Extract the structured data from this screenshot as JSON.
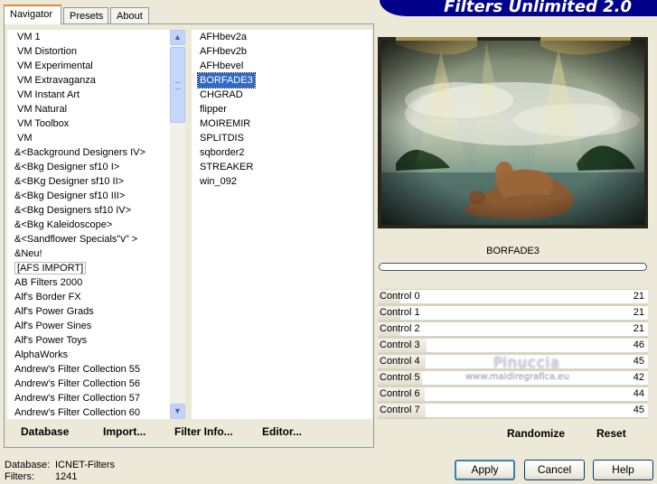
{
  "banner": {
    "title": "Filters Unlimited 2.0"
  },
  "tabs": [
    {
      "label": "Navigator"
    },
    {
      "label": "Presets"
    },
    {
      "label": "About"
    }
  ],
  "categories": [
    "VM 1",
    "VM Distortion",
    "VM Experimental",
    "VM Extravaganza",
    "VM Instant Art",
    "VM Natural",
    "VM Toolbox",
    "VM",
    "&<Background Designers IV>",
    "&<Bkg Designer sf10 I>",
    "&<BKg Designer sf10 II>",
    "&<Bkg Designer sf10 III>",
    "&<Bkg Designers sf10 IV>",
    "&<Bkg Kaleidoscope>",
    "&<Sandflower Specials\"v\" >",
    "&Neu!",
    "[AFS IMPORT]",
    "AB Filters 2000",
    "Alf's Border FX",
    "Alf's Power Grads",
    "Alf's Power Sines",
    "Alf's Power Toys",
    "AlphaWorks",
    "Andrew's Filter Collection 55",
    "Andrew's Filter Collection 56",
    "Andrew's Filter Collection 57",
    "Andrew's Filter Collection 60"
  ],
  "categories_selected": "[AFS IMPORT]",
  "filters": [
    "AFHbev2a",
    "AFHbev2b",
    "AFHbevel",
    "BORFADE3",
    "CHGRAD",
    "flipper",
    "MOIREMIR",
    "SPLITDIS",
    "sqborder2",
    "STREAKER",
    "win_092"
  ],
  "filters_selected": "BORFADE3",
  "toolbar": {
    "database": "Database",
    "import": "Import...",
    "filter_info": "Filter Info...",
    "editor": "Editor..."
  },
  "preview": {
    "filter_name": "BORFADE3"
  },
  "controls": [
    {
      "label": "Control 0",
      "value": "21",
      "level": 0.082
    },
    {
      "label": "Control 1",
      "value": "21",
      "level": 0.082
    },
    {
      "label": "Control 2",
      "value": "21",
      "level": 0.082
    },
    {
      "label": "Control 3",
      "value": "46",
      "level": 0.18
    },
    {
      "label": "Control 4",
      "value": "45",
      "level": 0.176
    },
    {
      "label": "Control 5",
      "value": "42",
      "level": 0.165
    },
    {
      "label": "Control 6",
      "value": "44",
      "level": 0.173
    },
    {
      "label": "Control 7",
      "value": "45",
      "level": 0.176
    }
  ],
  "watermark": {
    "name": "Pinuccia",
    "url": "www.maidiregrafica.eu"
  },
  "actions": {
    "randomize": "Randomize",
    "reset": "Reset"
  },
  "status": {
    "database_label": "Database:",
    "database_value": "ICNET-Filters",
    "filters_label": "Filters:",
    "filters_value": "1241"
  },
  "buttons": {
    "apply": "Apply",
    "cancel": "Cancel",
    "help": "Help"
  },
  "colors": {
    "selection": "#316ac5",
    "banner": "#00008b",
    "window": "#ece9d8"
  }
}
